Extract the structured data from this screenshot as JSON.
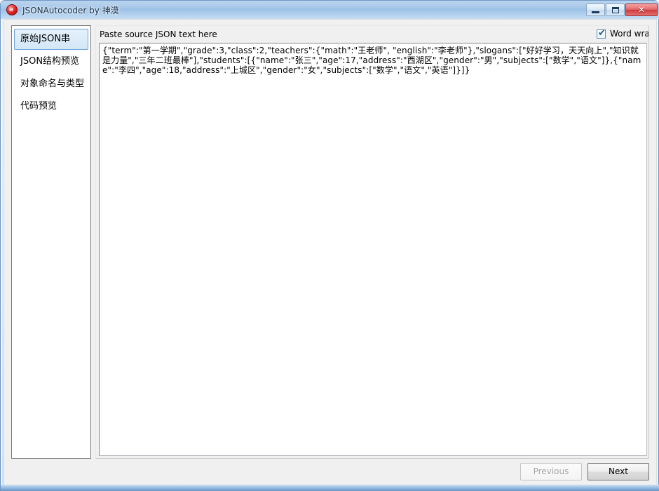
{
  "window": {
    "title": "JSONAutocoder by 神漠",
    "app_icon": "app-red-circle-icon",
    "controls": {
      "minimize": "minimize-icon",
      "maximize": "maximize-icon",
      "close": "✕"
    }
  },
  "sidebar": {
    "items": [
      {
        "label": "原始JSON串",
        "selected": true
      },
      {
        "label": "JSON结构预览",
        "selected": false
      },
      {
        "label": "对象命名与类型",
        "selected": false
      },
      {
        "label": "代码预览",
        "selected": false
      }
    ]
  },
  "panel": {
    "header_label": "Paste source JSON text here",
    "word_wrap": {
      "label": "Word wrap",
      "checked": true,
      "check_glyph": "✔"
    },
    "editor": {
      "value": "{\"term\":\"第一学期\",\"grade\":3,\"class\":2,\"teachers\":{\"math\":\"王老师\", \"english\":\"李老师\"},\"slogans\":[\"好好学习，天天向上\",\"知识就是力量\",\"三年二班最棒\"],\"students\":[{\"name\":\"张三\",\"age\":17,\"address\":\"西湖区\",\"gender\":\"男\",\"subjects\":[\"数学\",\"语文\"]},{\"name\":\"李四\",\"age\":18,\"address\":\"上城区\",\"gender\":\"女\",\"subjects\":[\"数学\",\"语文\",\"英语\"]}]}",
      "placeholder": "Paste source JSON text here"
    }
  },
  "footer": {
    "previous_label": "Previous",
    "previous_disabled": true,
    "next_label": "Next",
    "next_disabled": false
  },
  "colors": {
    "title_bar": "#a9c9e9",
    "frame_border": "#6f96c4",
    "selected_nav_bg": "#d3e7f8",
    "selected_nav_border": "#6ba2d8",
    "close_button": "#cf3b3b",
    "client_bg": "#f0f0f0"
  }
}
